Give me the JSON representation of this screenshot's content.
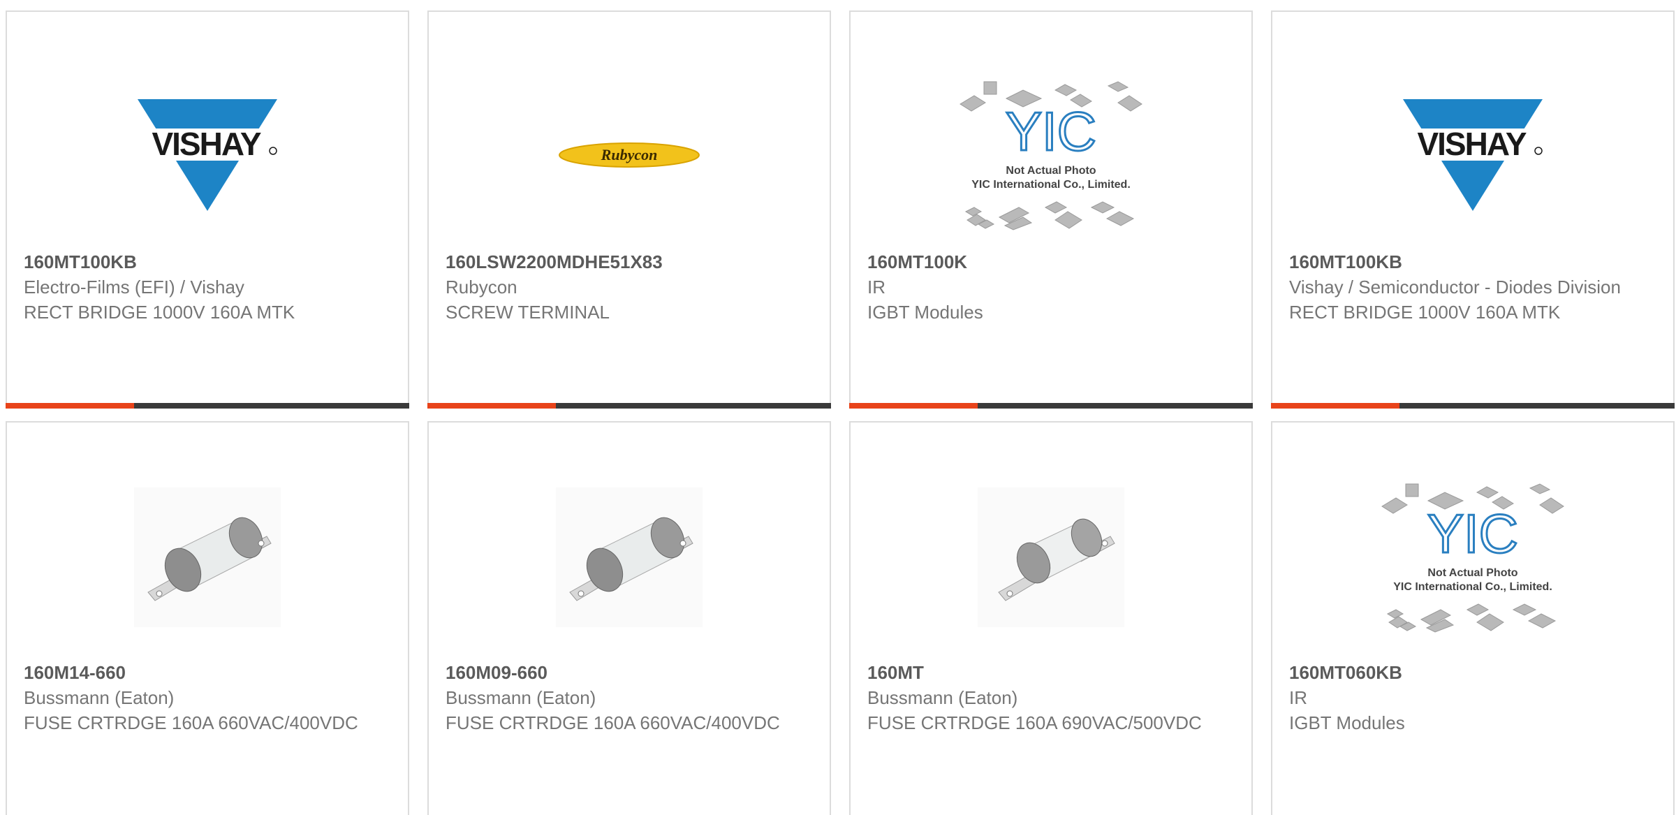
{
  "cards": [
    {
      "part": "160MT100KB",
      "manufacturer": "Electro-Films (EFI) / Vishay",
      "description": "RECT BRIDGE 1000V 160A MTK",
      "image": "vishay-logo",
      "logo_text": "VISHAY"
    },
    {
      "part": "160LSW2200MDHE51X83",
      "manufacturer": "Rubycon",
      "description": "SCREW TERMINAL",
      "image": "rubycon-logo",
      "logo_text": "Rubycon"
    },
    {
      "part": "160MT100K",
      "manufacturer": "IR",
      "description": "IGBT Modules",
      "image": "yic-placeholder",
      "logo_text": "YIC",
      "caption_line1": "Not Actual Photo",
      "caption_line2": "YIC International Co., Limited."
    },
    {
      "part": "160MT100KB",
      "manufacturer": "Vishay / Semiconductor - Diodes Division",
      "description": "RECT BRIDGE 1000V 160A MTK",
      "image": "vishay-logo",
      "logo_text": "VISHAY"
    },
    {
      "part": "160M14-660",
      "manufacturer": "Bussmann (Eaton)",
      "description": "FUSE CRTRDGE 160A 660VAC/400VDC",
      "image": "fuse-photo"
    },
    {
      "part": "160M09-660",
      "manufacturer": "Bussmann (Eaton)",
      "description": "FUSE CRTRDGE 160A 660VAC/400VDC",
      "image": "fuse-photo"
    },
    {
      "part": "160MT",
      "manufacturer": "Bussmann (Eaton)",
      "description": "FUSE CRTRDGE 160A 690VAC/500VDC",
      "image": "fuse-photo"
    },
    {
      "part": "160MT060KB",
      "manufacturer": "IR",
      "description": "IGBT Modules",
      "image": "yic-placeholder",
      "logo_text": "YIC",
      "caption_line1": "Not Actual Photo",
      "caption_line2": "YIC International Co., Limited."
    }
  ],
  "colors": {
    "accent": "#e8431a",
    "bar": "#3a3a3a",
    "vishay_blue": "#1d84c6",
    "rubycon_yellow": "#f2c21b",
    "yic_blue": "#2a7fc0"
  }
}
